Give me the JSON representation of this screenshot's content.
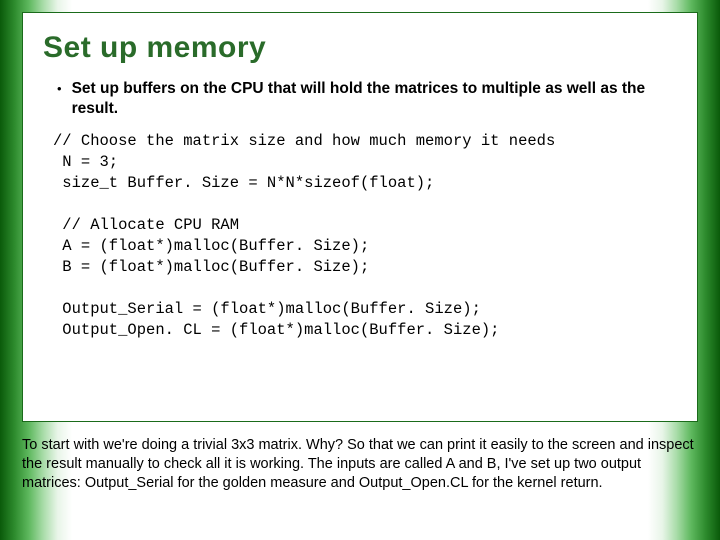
{
  "title": "Set up memory",
  "bullet": "Set up buffers on the CPU that will hold the matrices to multiple as well as the result.",
  "code": "// Choose the matrix size and how much memory it needs\n N = 3;\n size_t Buffer. Size = N*N*sizeof(float);\n\n // Allocate CPU RAM\n A = (float*)malloc(Buffer. Size);\n B = (float*)malloc(Buffer. Size);\n\n Output_Serial = (float*)malloc(Buffer. Size);\n Output_Open. CL = (float*)malloc(Buffer. Size);",
  "footer": "To start with we're doing a trivial 3x3 matrix. Why? So that we can print it easily to the screen and inspect the result manually to check all it is working.\nThe inputs are called A and B, I've set up two output matrices:\nOutput_Serial for the golden measure and Output_Open.CL for the kernel return."
}
